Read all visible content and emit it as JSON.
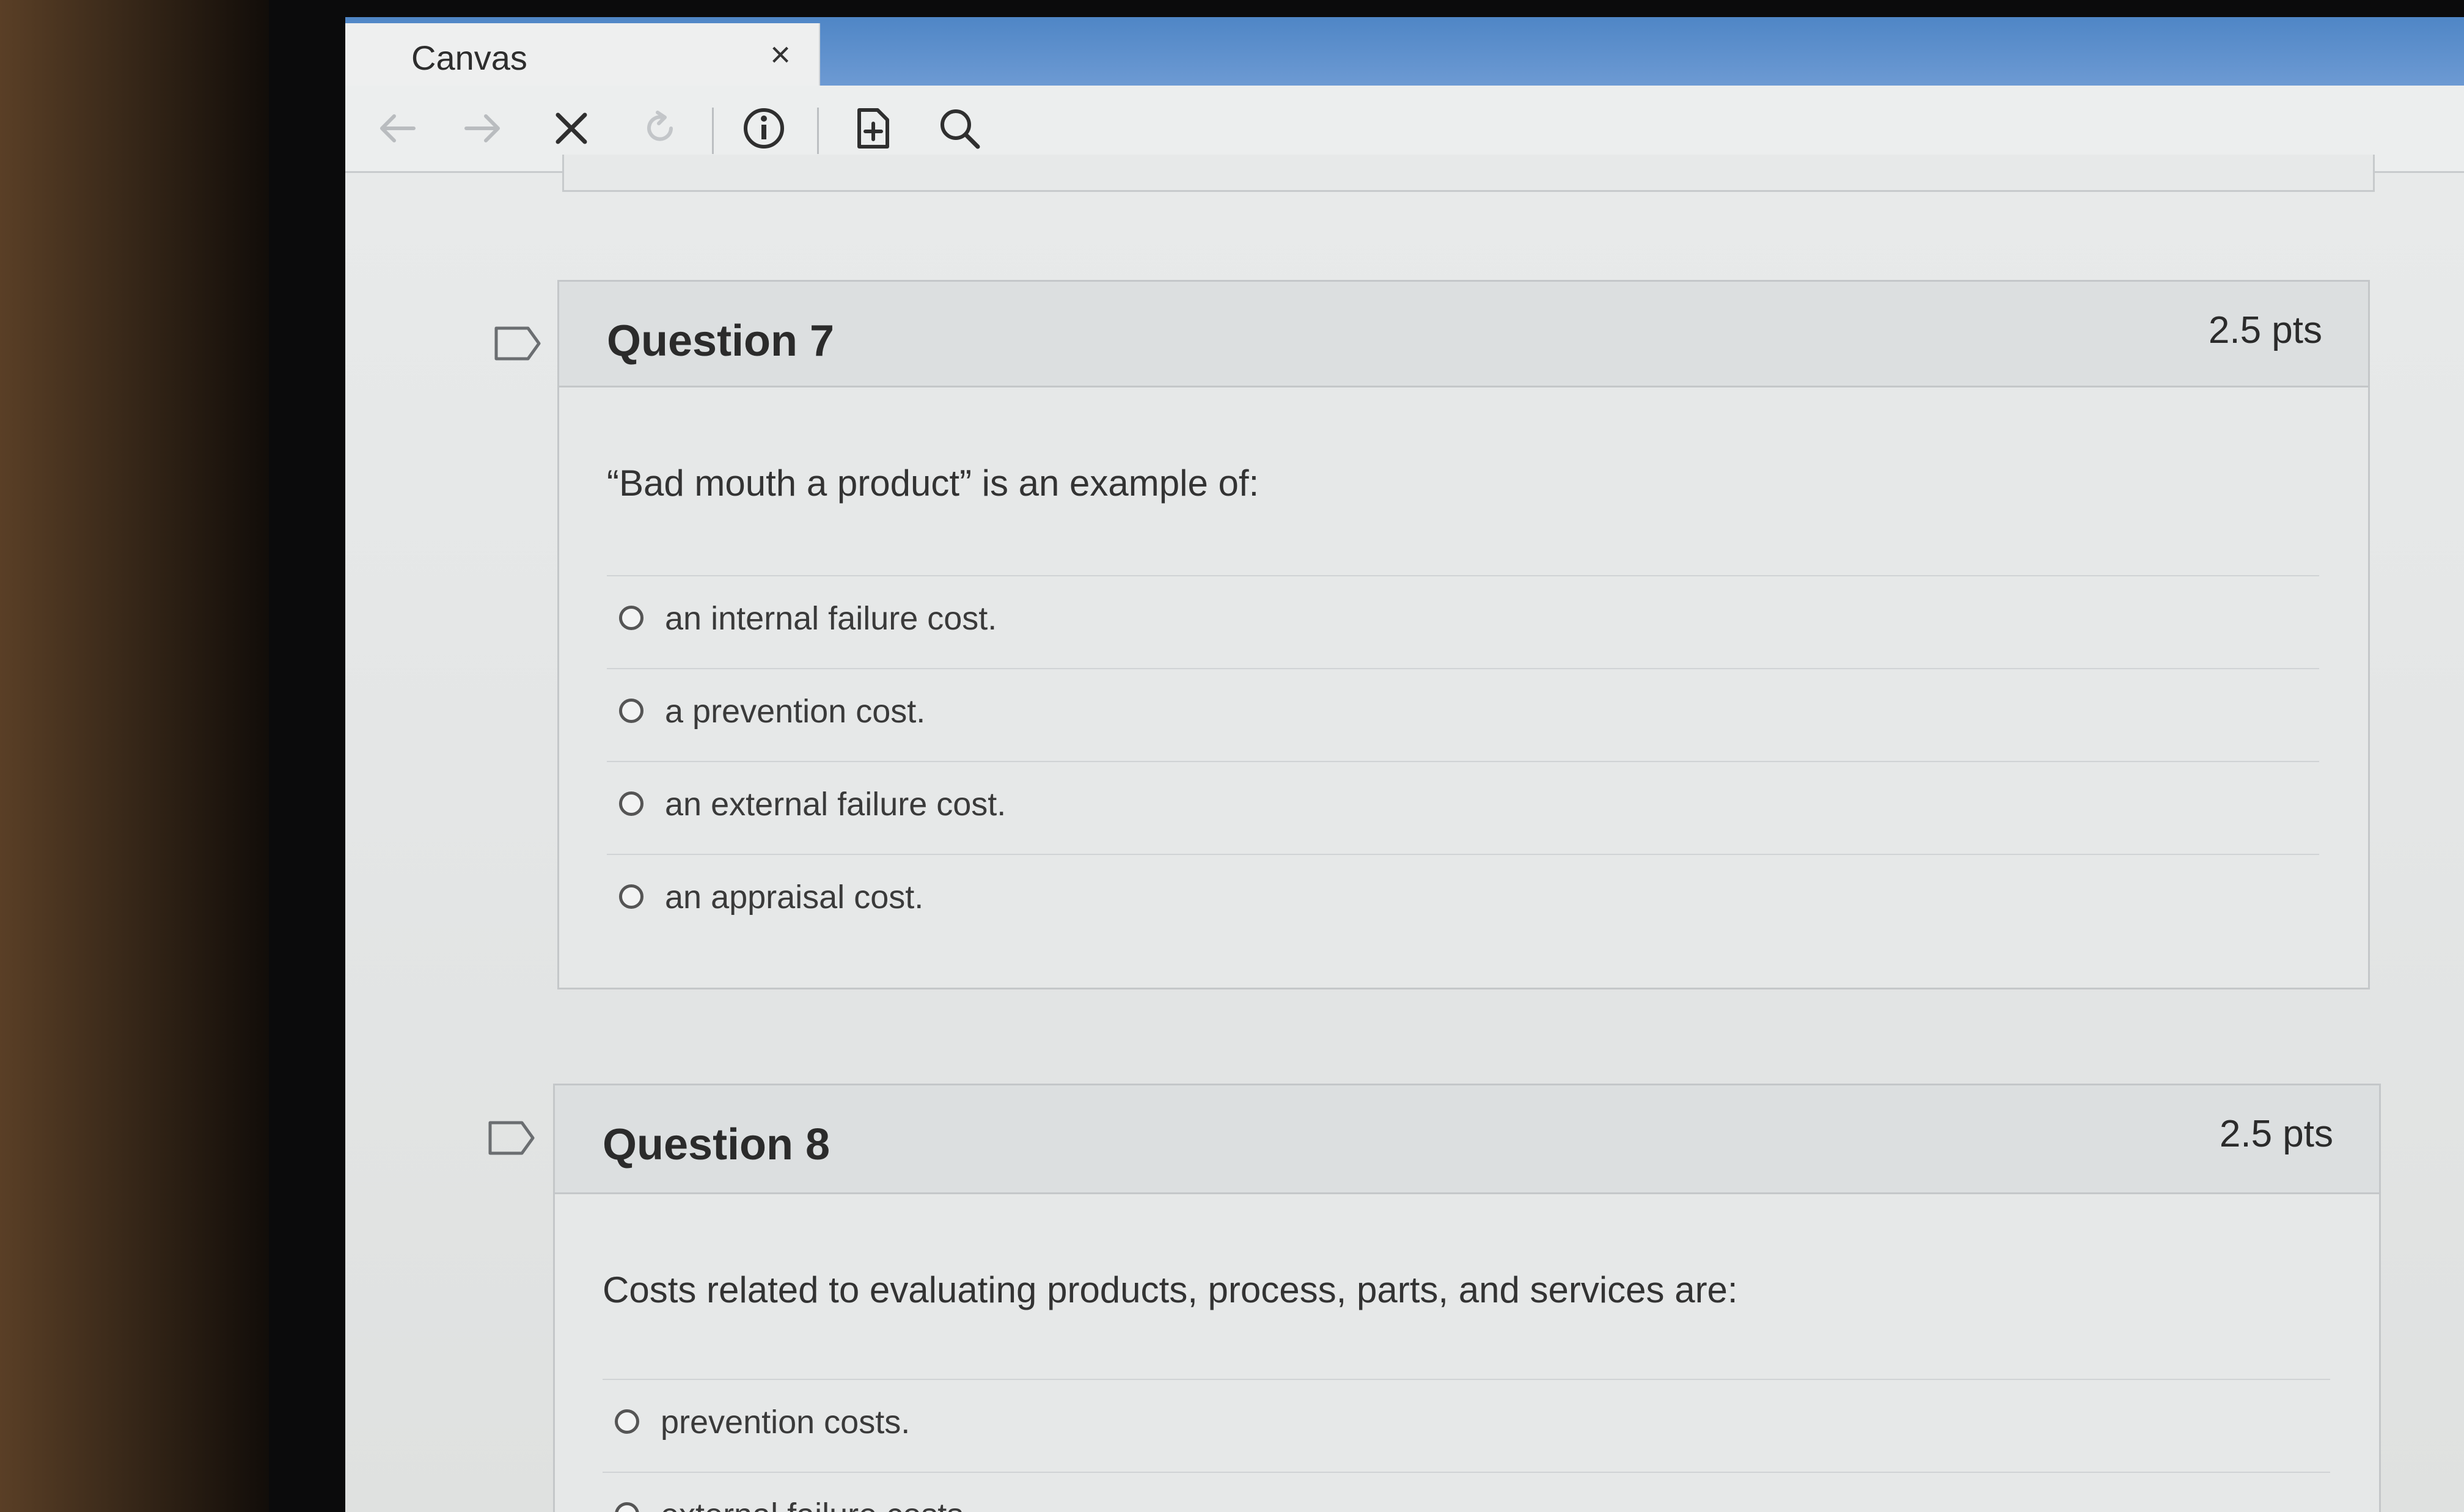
{
  "window": {
    "tab_title": "Canvas",
    "tab_close": "×"
  },
  "toolbar": {
    "buttons": [
      "back-icon",
      "forward-icon",
      "stop-icon",
      "reload-icon",
      "info-icon",
      "add-page-icon",
      "search-icon"
    ]
  },
  "questions": [
    {
      "title": "Question 7",
      "points": "2.5 pts",
      "text": "“Bad mouth a product” is an example of:",
      "answers": [
        "an internal failure cost.",
        "a prevention cost.",
        "an external failure cost.",
        "an appraisal cost."
      ]
    },
    {
      "title": "Question 8",
      "points": "2.5 pts",
      "text": "Costs related to evaluating products, process, parts, and services are:",
      "answers": [
        "prevention costs.",
        "external failure costs."
      ]
    }
  ],
  "colors": {
    "titlebar": "#5b8fcd",
    "page_bg": "#e6e8e8",
    "header_bg": "#dcdfe0"
  }
}
